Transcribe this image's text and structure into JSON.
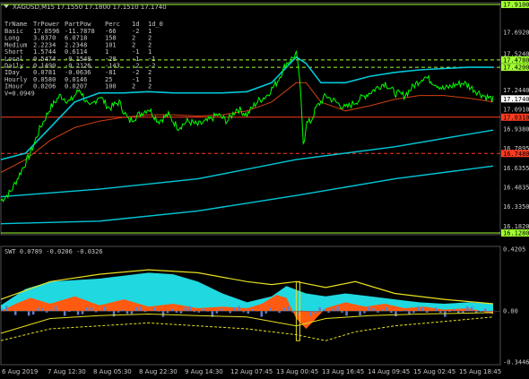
{
  "header": {
    "title": "XAGUSD,M15  17.1550 17.1800 17.1510 17.1740"
  },
  "table": {
    "columns": [
      "TrName",
      "TrPower",
      "PartPow",
      "Perc",
      "1d",
      "1d_0"
    ],
    "rows": [
      [
        "Basic",
        "17.8596",
        "-11.7878",
        "-66",
        "-2",
        "1"
      ],
      [
        "Long",
        "3.8370",
        "6.0718",
        "158",
        "2",
        "2"
      ],
      [
        "Medium",
        "2.2234",
        "2.2348",
        "101",
        "2",
        "2"
      ],
      [
        "Short",
        "1.5744",
        "0.6114",
        "1",
        "-1",
        "1"
      ],
      [
        "Local",
        "0.5474",
        "-0.1548",
        "-28",
        "-1",
        "-1"
      ],
      [
        "Daily",
        "0.1490",
        "-0.2126",
        "-143",
        "-2",
        "-2"
      ],
      [
        "IDay",
        "0.0781",
        "-0.0636",
        "-81",
        "-2",
        "2"
      ],
      [
        "Hourly",
        "0.0580",
        "0.0146",
        "25",
        "-1",
        "1"
      ],
      [
        "IHour",
        "0.0206",
        "0.0207",
        "100",
        "2",
        "2"
      ]
    ],
    "footer": "V=0.0949"
  },
  "indicator": {
    "title": "SWT 0.0789 -0.0206 -0.0326"
  },
  "colors": {
    "background": "#000000",
    "price": "#00ff00",
    "band": "#00c8d8",
    "ma": "#d04010",
    "level_green": "#a0ff30",
    "level_red": "#ff3b1f",
    "area_cyan": "#20d8e0",
    "area_orange": "#ff5a10",
    "yellow": "#e8e020",
    "blue_hist": "#6080d0"
  },
  "chart_data": [
    {
      "type": "line",
      "ylim": [
        16.128,
        17.91
      ],
      "price_axis_labels": [
        "17.9100",
        "17.6920",
        "17.5240",
        "17.4780",
        "17.4200",
        "17.2440",
        "17.1740",
        "17.0910",
        "17.0310",
        "16.9380",
        "16.7895",
        "16.7480",
        "16.6355",
        "16.4835",
        "16.3350",
        "16.1820",
        "16.1280"
      ],
      "highlighted_labels": [
        {
          "value": "17.9100",
          "color": "#a0ff30"
        },
        {
          "value": "17.4780",
          "color": "#a0ff30"
        },
        {
          "value": "17.4200",
          "color": "#a0ff30"
        },
        {
          "value": "17.1740",
          "color": "#ffffff"
        },
        {
          "value": "17.0310",
          "color": "#ff3b1f"
        },
        {
          "value": "16.7480",
          "color": "#ff3b1f"
        },
        {
          "value": "16.1280",
          "color": "#a0ff30"
        }
      ],
      "levels": [
        {
          "value": 17.91,
          "color": "#a0ff30",
          "style": "solid"
        },
        {
          "value": 17.478,
          "color": "#a0ff30",
          "style": "dashed"
        },
        {
          "value": 17.42,
          "color": "#a0ff30",
          "style": "dashed"
        },
        {
          "value": 17.031,
          "color": "#ff3b1f",
          "style": "solid"
        },
        {
          "value": 16.748,
          "color": "#ff3b1f",
          "style": "dashed"
        },
        {
          "value": 16.128,
          "color": "#a0ff30",
          "style": "solid"
        }
      ],
      "x_tick_labels": [
        "6 Aug 2019",
        "7 Aug 12:30",
        "8 Aug 05:30",
        "8 Aug 22:30",
        "9 Aug 14:30",
        "12 Aug 07:45",
        "13 Aug 00:45",
        "13 Aug 16:45",
        "14 Aug 09:45",
        "15 Aug 02:45",
        "15 Aug 18:45"
      ],
      "price_series": [
        [
          0,
          16.38
        ],
        [
          0.02,
          16.45
        ],
        [
          0.04,
          16.6
        ],
        [
          0.06,
          16.75
        ],
        [
          0.08,
          16.95
        ],
        [
          0.1,
          17.1
        ],
        [
          0.12,
          17.2
        ],
        [
          0.14,
          17.15
        ],
        [
          0.16,
          17.25
        ],
        [
          0.18,
          17.1
        ],
        [
          0.2,
          17.2
        ],
        [
          0.22,
          17.1
        ],
        [
          0.24,
          17.15
        ],
        [
          0.26,
          17.0
        ],
        [
          0.28,
          17.05
        ],
        [
          0.3,
          17.1
        ],
        [
          0.32,
          17.0
        ],
        [
          0.34,
          17.05
        ],
        [
          0.36,
          16.95
        ],
        [
          0.38,
          17.0
        ],
        [
          0.4,
          16.97
        ],
        [
          0.42,
          17.0
        ],
        [
          0.44,
          17.05
        ],
        [
          0.46,
          17.0
        ],
        [
          0.48,
          17.1
        ],
        [
          0.5,
          17.05
        ],
        [
          0.52,
          17.15
        ],
        [
          0.54,
          17.2
        ],
        [
          0.56,
          17.3
        ],
        [
          0.58,
          17.45
        ],
        [
          0.6,
          17.52
        ],
        [
          0.605,
          17.4
        ],
        [
          0.61,
          17.15
        ],
        [
          0.615,
          16.8
        ],
        [
          0.62,
          16.98
        ],
        [
          0.63,
          17.0
        ],
        [
          0.64,
          17.1
        ],
        [
          0.66,
          17.2
        ],
        [
          0.68,
          17.15
        ],
        [
          0.7,
          17.1
        ],
        [
          0.72,
          17.15
        ],
        [
          0.74,
          17.2
        ],
        [
          0.76,
          17.25
        ],
        [
          0.78,
          17.3
        ],
        [
          0.8,
          17.22
        ],
        [
          0.82,
          17.2
        ],
        [
          0.84,
          17.28
        ],
        [
          0.86,
          17.35
        ],
        [
          0.88,
          17.3
        ],
        [
          0.9,
          17.25
        ],
        [
          0.92,
          17.28
        ],
        [
          0.94,
          17.3
        ],
        [
          0.96,
          17.25
        ],
        [
          0.98,
          17.2
        ],
        [
          1.0,
          17.17
        ]
      ],
      "band_series": [
        [
          0,
          16.7
        ],
        [
          0.05,
          16.75
        ],
        [
          0.1,
          16.95
        ],
        [
          0.15,
          17.15
        ],
        [
          0.2,
          17.22
        ],
        [
          0.25,
          17.22
        ],
        [
          0.3,
          17.23
        ],
        [
          0.35,
          17.22
        ],
        [
          0.4,
          17.22
        ],
        [
          0.45,
          17.22
        ],
        [
          0.5,
          17.23
        ],
        [
          0.55,
          17.3
        ],
        [
          0.6,
          17.5
        ],
        [
          0.62,
          17.45
        ],
        [
          0.65,
          17.3
        ],
        [
          0.7,
          17.3
        ],
        [
          0.75,
          17.35
        ],
        [
          0.8,
          17.38
        ],
        [
          0.85,
          17.4
        ],
        [
          0.9,
          17.41
        ],
        [
          0.95,
          17.42
        ],
        [
          1.0,
          17.42
        ]
      ],
      "ma_series": [
        [
          0,
          16.6
        ],
        [
          0.05,
          16.7
        ],
        [
          0.1,
          16.85
        ],
        [
          0.15,
          16.95
        ],
        [
          0.2,
          17.0
        ],
        [
          0.25,
          17.03
        ],
        [
          0.3,
          17.05
        ],
        [
          0.35,
          17.05
        ],
        [
          0.4,
          17.04
        ],
        [
          0.45,
          17.05
        ],
        [
          0.5,
          17.08
        ],
        [
          0.55,
          17.15
        ],
        [
          0.6,
          17.3
        ],
        [
          0.62,
          17.3
        ],
        [
          0.65,
          17.15
        ],
        [
          0.7,
          17.08
        ],
        [
          0.75,
          17.12
        ],
        [
          0.8,
          17.17
        ],
        [
          0.85,
          17.2
        ],
        [
          0.9,
          17.2
        ],
        [
          0.95,
          17.18
        ],
        [
          1.0,
          17.15
        ]
      ],
      "trend_series": [
        [
          0,
          16.41
        ],
        [
          0.2,
          16.47
        ],
        [
          0.4,
          16.55
        ],
        [
          0.6,
          16.7
        ],
        [
          0.8,
          16.8
        ],
        [
          1.0,
          16.93
        ]
      ],
      "low_series": [
        [
          0,
          16.2
        ],
        [
          0.2,
          16.22
        ],
        [
          0.4,
          16.3
        ],
        [
          0.6,
          16.42
        ],
        [
          0.8,
          16.55
        ],
        [
          1.0,
          16.65
        ]
      ]
    },
    {
      "type": "area",
      "title": "SWT 0.0789 -0.0206 -0.0326",
      "ylim": [
        -0.3446,
        0.4205
      ],
      "y_tick_labels": [
        "0.4205",
        "0.00",
        "-0.3446"
      ]
    }
  ]
}
